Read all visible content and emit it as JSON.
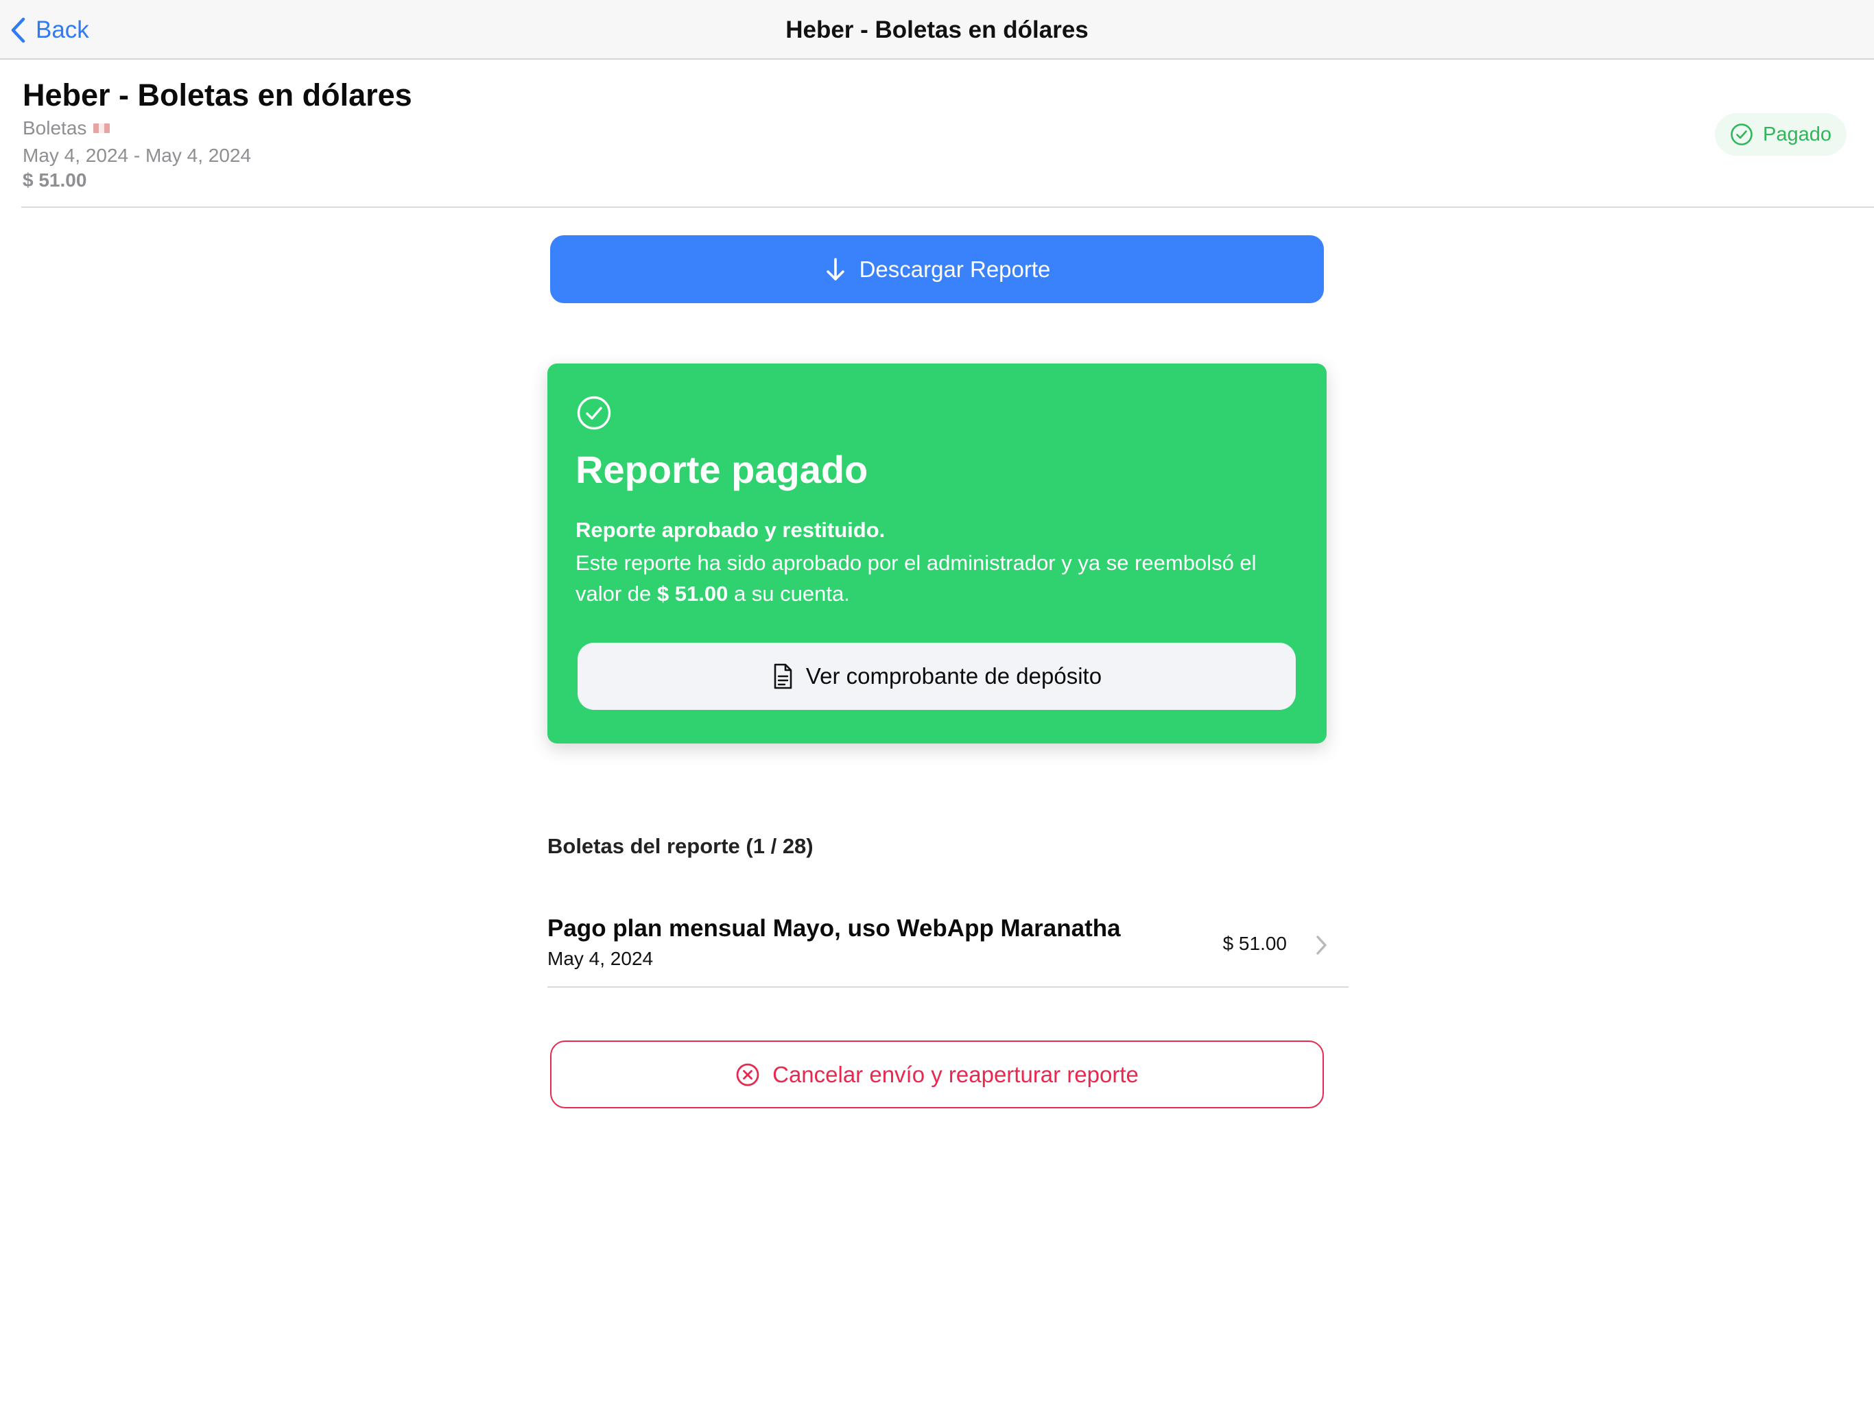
{
  "nav": {
    "back_label": "Back",
    "title": "Heber - Boletas en dólares"
  },
  "header": {
    "title": "Heber - Boletas en dólares",
    "category": "Boletas",
    "flag_icon": "peru-flag-icon",
    "date_range": "May 4, 2024 - May 4, 2024",
    "amount": "$ 51.00",
    "status": "Pagado",
    "status_color": "#2fb55a"
  },
  "actions": {
    "download_label": "Descargar Reporte",
    "download_icon": "arrow-down-icon",
    "accent_color": "#3a82fb"
  },
  "paid_card": {
    "icon": "check-circle-icon",
    "title": "Reporte pagado",
    "subtitle": "Reporte aprobado y restituido.",
    "text_prefix": "Este reporte ha sido aprobado por el administrador y ya se reembolsó el valor de ",
    "text_amount": "$ 51.00",
    "text_suffix": " a su cuenta.",
    "receipt_button_label": "Ver comprobante de depósito",
    "receipt_icon": "document-icon",
    "background_color": "#30d26f"
  },
  "receipts": {
    "section_title": "Boletas del reporte (1 / 28)",
    "items": [
      {
        "title": "Pago plan mensual Mayo, uso WebApp Maranatha",
        "date": "May 4, 2024",
        "amount": "$ 51.00"
      }
    ]
  },
  "cancel": {
    "label": "Cancelar envío y reaperturar reporte",
    "icon": "x-circle-icon",
    "color": "#e8294f"
  }
}
